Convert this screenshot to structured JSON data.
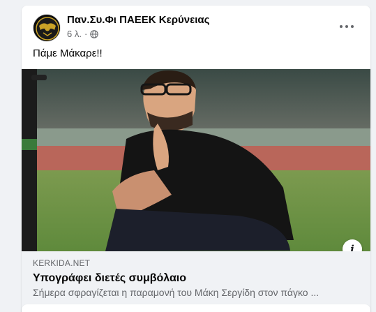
{
  "post": {
    "author": "Παν.Συ.Φι ΠΑΕΕΚ Κερύνειας",
    "time": "6 λ.",
    "separator": "·",
    "privacy_icon": "globe-icon",
    "more_icon": "more-options-icon",
    "caption": "Πάμε Μάκαρε!!"
  },
  "link_preview": {
    "domain": "KERKIDA.NET",
    "title": "Υπογράφει διετές συμβόλαιο",
    "description": "Σήμερα σφραγίζεται η παραμονή του Μάκη Σεργίδη στον πάγκο ...",
    "info_label": "i"
  },
  "colors": {
    "card_bg": "#ffffff",
    "page_bg": "#f0f2f5",
    "secondary_text": "#65676b",
    "link_info_bg": "#f0f2f5"
  }
}
